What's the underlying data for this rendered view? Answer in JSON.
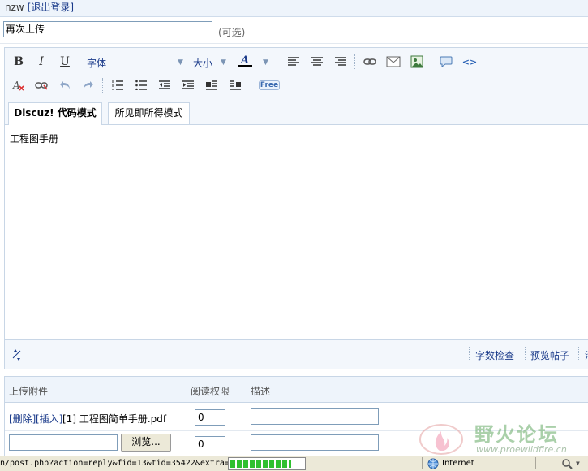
{
  "user": {
    "name": "nzw",
    "logout": "[退出登录]"
  },
  "subject": {
    "value": "再次上传",
    "hint": "(可选)"
  },
  "toolbar": {
    "font_label": "字体",
    "size_label": "大小",
    "free_label": "Free",
    "text_color": "#000000"
  },
  "tabs": {
    "code_mode": "Discuz! 代码模式",
    "wysiwyg_mode": "所见即所得模式"
  },
  "editor": {
    "content": "工程图手册"
  },
  "bottombar": {
    "word_check": "字数检查",
    "preview": "预览帖子",
    "more": "清"
  },
  "attachments": {
    "header": {
      "upload": "上传附件",
      "perm": "阅读权限",
      "desc": "描述"
    },
    "rows": [
      {
        "delete": "[删除]",
        "insert": "[插入]",
        "name": "[1] 工程图简单手册.pdf",
        "perm": "0",
        "desc": ""
      }
    ],
    "new_row": {
      "browse": "浏览...",
      "perm": "0"
    }
  },
  "statusbar": {
    "url": "n/post.php?action=reply&fid=13&tid=35422&extra=",
    "progress": 0.85,
    "zone": "Internet"
  },
  "watermark": {
    "cn": "野火论坛",
    "en": "www.proewildfire.cn"
  },
  "colors": {
    "accent": "#1a3a8a",
    "toolbar_bg": "#f3f7fc",
    "border": "#c8d6e6"
  }
}
